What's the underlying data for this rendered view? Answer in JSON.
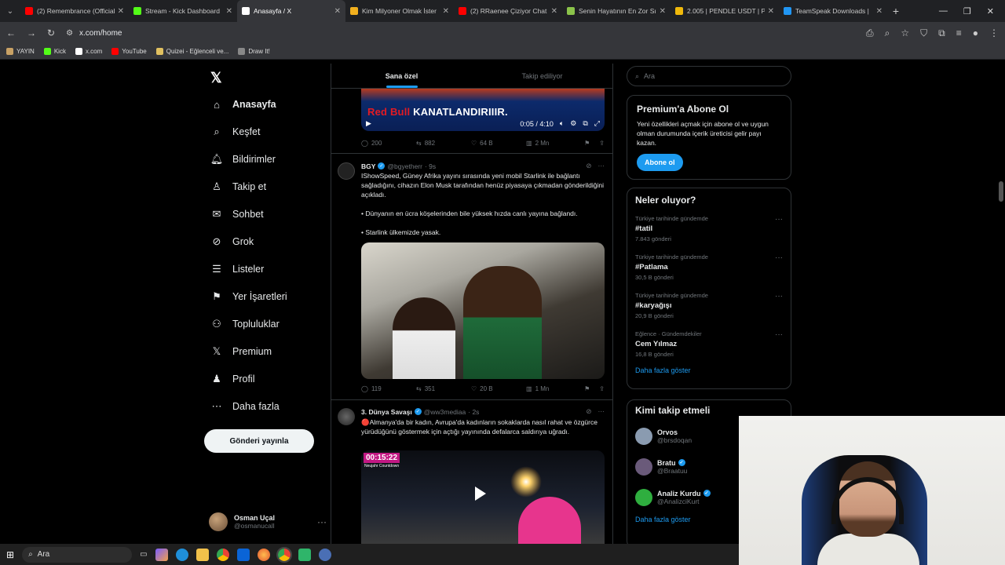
{
  "browser": {
    "tabs": [
      {
        "title": "(2) Remembrance (Official",
        "color": "#ff0000",
        "active": false
      },
      {
        "title": "Stream - Kick Dashboard",
        "color": "#53fc18",
        "active": false
      },
      {
        "title": "Anasayfa / X",
        "color": "#ffffff",
        "active": true
      },
      {
        "title": "Kim Milyoner Olmak İster",
        "color": "#f2b01e",
        "active": false
      },
      {
        "title": "(2) RRaenee Çiziyor Chat",
        "color": "#ff0000",
        "active": false
      },
      {
        "title": "Senin Hayatının En Zor Sı",
        "color": "#8bc34a",
        "active": false
      },
      {
        "title": "2.005 | PENDLE USDT | Pe",
        "color": "#f0b90b",
        "active": false
      },
      {
        "title": "TeamSpeak Downloads |",
        "color": "#2196f3",
        "active": false
      }
    ],
    "url": "x.com/home",
    "bookmarks": [
      {
        "label": "YAYIN",
        "color": "#c8a165"
      },
      {
        "label": "Kick",
        "color": "#53fc18"
      },
      {
        "label": "x.com",
        "color": "#ffffff"
      },
      {
        "label": "YouTube",
        "color": "#ff0000"
      },
      {
        "label": "Quizei - Eğlenceli ve...",
        "color": "#e0c060"
      },
      {
        "label": "Draw It!",
        "color": "#888888"
      }
    ]
  },
  "nav": {
    "items": [
      {
        "label": "Anasayfa",
        "icon": "home-icon",
        "glyph": "⌂"
      },
      {
        "label": "Keşfet",
        "icon": "search-icon",
        "glyph": "⌕"
      },
      {
        "label": "Bildirimler",
        "icon": "bell-icon",
        "glyph": "🔔︎"
      },
      {
        "label": "Takip et",
        "icon": "add-person-icon",
        "glyph": "♙"
      },
      {
        "label": "Sohbet",
        "icon": "mail-icon",
        "glyph": "✉"
      },
      {
        "label": "Grok",
        "icon": "grok-icon",
        "glyph": "⊘"
      },
      {
        "label": "Listeler",
        "icon": "list-icon",
        "glyph": "☰"
      },
      {
        "label": "Yer İşaretleri",
        "icon": "bookmark-icon",
        "glyph": "⚑"
      },
      {
        "label": "Topluluklar",
        "icon": "communities-icon",
        "glyph": "⚇"
      },
      {
        "label": "Premium",
        "icon": "x-logo-icon",
        "glyph": "𝕏"
      },
      {
        "label": "Profil",
        "icon": "profile-icon",
        "glyph": "♟"
      },
      {
        "label": "Daha fazla",
        "icon": "more-circle-icon",
        "glyph": "⋯"
      }
    ],
    "post_button": "Gönderi yayınla",
    "profile": {
      "name": "Osman Uçal",
      "handle": "@osmanucall"
    }
  },
  "feed": {
    "tabs": [
      "Sana özel",
      "Takip ediliyor"
    ],
    "video1": {
      "title_red": "Red Bull",
      "title_rest": "KANATLANDIRIIIR.",
      "time": "0:05 / 4:10"
    },
    "post1_stats": {
      "replies": "200",
      "reposts": "882",
      "likes": "64 B",
      "views": "2 Mn"
    },
    "post2": {
      "name": "BGY",
      "handle": "@bgyetherr",
      "time": "· 9s",
      "text1": "IShowSpeed, Güney Afrika yayını sırasında yeni mobil Starlink ile bağlantı sağladığını, cihazın Elon Musk tarafından henüz piyasaya çıkmadan gönderildiğini açıkladı.",
      "text2": "• Dünyanın en ücra köşelerinden bile yüksek hızda canlı yayına bağlandı.",
      "text3": "• Starlink ülkemizde yasak.",
      "stats": {
        "replies": "119",
        "reposts": "351",
        "likes": "20 B",
        "views": "1 Mn"
      }
    },
    "post3": {
      "name": "3. Dünya Savaşı",
      "handle": "@ww3mediaa",
      "time": "· 2s",
      "text": "🔴Almanya'da bir kadın, Avrupa'da kadınların sokaklarda nasıl rahat ve özgürce yürüdüğünü göstermek için açtığı yayınında defalarca saldırıya uğradı.",
      "video_time": "00:15:22",
      "video_sub": "Neujahr Countdown"
    }
  },
  "right": {
    "search_placeholder": "Ara",
    "premium": {
      "title": "Premium'a Abone Ol",
      "text": "Yeni özellikleri açmak için abone ol ve uygun olman durumunda içerik üreticisi gelir payı kazan.",
      "button": "Abone ol"
    },
    "trends_title": "Neler oluyor?",
    "trends": [
      {
        "context": "Türkiye tarihinde gündemde",
        "tag": "#tatil",
        "count": "7.843 gönderi"
      },
      {
        "context": "Türkiye tarihinde gündemde",
        "tag": "#Patlama",
        "count": "30,5 B gönderi"
      },
      {
        "context": "Türkiye tarihinde gündemde",
        "tag": "#karyağışı",
        "count": "20,9 B gönderi"
      },
      {
        "context": "Eğlence · Gündemdekiler",
        "tag": "Cem Yılmaz",
        "count": "16,8 B gönderi"
      }
    ],
    "trends_more": "Daha fazla göster",
    "who_title": "Kimi takip etmeli",
    "who": [
      {
        "name": "Orvos",
        "handle": "@brsdoqan",
        "verified": false,
        "color": "#8a9bb0"
      },
      {
        "name": "Bratu",
        "handle": "@Braatuu",
        "verified": true,
        "color": "#6a5a7a"
      },
      {
        "name": "Analiz Kurdu",
        "handle": "@AnalizciKurt",
        "verified": true,
        "color": "#2fae3f"
      }
    ],
    "who_more": "Daha fazla göster"
  },
  "taskbar": {
    "search": "Ara"
  }
}
